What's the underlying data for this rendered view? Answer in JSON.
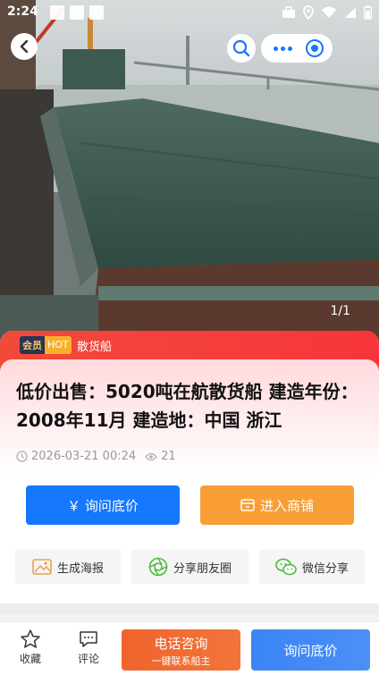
{
  "status_bar": {
    "time": "2:24"
  },
  "hero": {
    "photo_counter": "1/1"
  },
  "listing": {
    "badge_vip": "会员",
    "badge_hot": "HOT",
    "category": "散货船",
    "title": "低价出售：5020吨在航散货船 建造年份：2008年11月 建造地：中国 浙江",
    "datetime": "2026-03-21 00:24",
    "views": "21"
  },
  "actions": {
    "inquiry_label": "￥ 询问底价",
    "shop_label": "进入商铺"
  },
  "share": {
    "poster_label": "生成海报",
    "moments_label": "分享朋友圈",
    "wechat_label": "微信分享"
  },
  "bottom_bar": {
    "favorite_label": "收藏",
    "comment_label": "评论",
    "call_label": "电话咨询",
    "call_sub_label": "一键联系船主",
    "inquiry_label": "询问底价"
  },
  "colors": {
    "primary_blue": "#1677ff",
    "orange": "#f89e35",
    "red_header": "#f24a3a"
  }
}
